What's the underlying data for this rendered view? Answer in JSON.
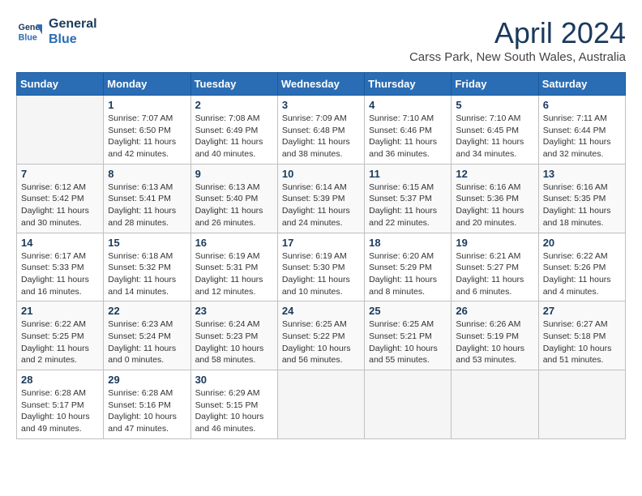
{
  "logo": {
    "line1": "General",
    "line2": "Blue"
  },
  "title": "April 2024",
  "subtitle": "Carss Park, New South Wales, Australia",
  "days_of_week": [
    "Sunday",
    "Monday",
    "Tuesday",
    "Wednesday",
    "Thursday",
    "Friday",
    "Saturday"
  ],
  "weeks": [
    [
      {
        "num": "",
        "detail": ""
      },
      {
        "num": "1",
        "detail": "Sunrise: 7:07 AM\nSunset: 6:50 PM\nDaylight: 11 hours\nand 42 minutes."
      },
      {
        "num": "2",
        "detail": "Sunrise: 7:08 AM\nSunset: 6:49 PM\nDaylight: 11 hours\nand 40 minutes."
      },
      {
        "num": "3",
        "detail": "Sunrise: 7:09 AM\nSunset: 6:48 PM\nDaylight: 11 hours\nand 38 minutes."
      },
      {
        "num": "4",
        "detail": "Sunrise: 7:10 AM\nSunset: 6:46 PM\nDaylight: 11 hours\nand 36 minutes."
      },
      {
        "num": "5",
        "detail": "Sunrise: 7:10 AM\nSunset: 6:45 PM\nDaylight: 11 hours\nand 34 minutes."
      },
      {
        "num": "6",
        "detail": "Sunrise: 7:11 AM\nSunset: 6:44 PM\nDaylight: 11 hours\nand 32 minutes."
      }
    ],
    [
      {
        "num": "7",
        "detail": "Sunrise: 6:12 AM\nSunset: 5:42 PM\nDaylight: 11 hours\nand 30 minutes."
      },
      {
        "num": "8",
        "detail": "Sunrise: 6:13 AM\nSunset: 5:41 PM\nDaylight: 11 hours\nand 28 minutes."
      },
      {
        "num": "9",
        "detail": "Sunrise: 6:13 AM\nSunset: 5:40 PM\nDaylight: 11 hours\nand 26 minutes."
      },
      {
        "num": "10",
        "detail": "Sunrise: 6:14 AM\nSunset: 5:39 PM\nDaylight: 11 hours\nand 24 minutes."
      },
      {
        "num": "11",
        "detail": "Sunrise: 6:15 AM\nSunset: 5:37 PM\nDaylight: 11 hours\nand 22 minutes."
      },
      {
        "num": "12",
        "detail": "Sunrise: 6:16 AM\nSunset: 5:36 PM\nDaylight: 11 hours\nand 20 minutes."
      },
      {
        "num": "13",
        "detail": "Sunrise: 6:16 AM\nSunset: 5:35 PM\nDaylight: 11 hours\nand 18 minutes."
      }
    ],
    [
      {
        "num": "14",
        "detail": "Sunrise: 6:17 AM\nSunset: 5:33 PM\nDaylight: 11 hours\nand 16 minutes."
      },
      {
        "num": "15",
        "detail": "Sunrise: 6:18 AM\nSunset: 5:32 PM\nDaylight: 11 hours\nand 14 minutes."
      },
      {
        "num": "16",
        "detail": "Sunrise: 6:19 AM\nSunset: 5:31 PM\nDaylight: 11 hours\nand 12 minutes."
      },
      {
        "num": "17",
        "detail": "Sunrise: 6:19 AM\nSunset: 5:30 PM\nDaylight: 11 hours\nand 10 minutes."
      },
      {
        "num": "18",
        "detail": "Sunrise: 6:20 AM\nSunset: 5:29 PM\nDaylight: 11 hours\nand 8 minutes."
      },
      {
        "num": "19",
        "detail": "Sunrise: 6:21 AM\nSunset: 5:27 PM\nDaylight: 11 hours\nand 6 minutes."
      },
      {
        "num": "20",
        "detail": "Sunrise: 6:22 AM\nSunset: 5:26 PM\nDaylight: 11 hours\nand 4 minutes."
      }
    ],
    [
      {
        "num": "21",
        "detail": "Sunrise: 6:22 AM\nSunset: 5:25 PM\nDaylight: 11 hours\nand 2 minutes."
      },
      {
        "num": "22",
        "detail": "Sunrise: 6:23 AM\nSunset: 5:24 PM\nDaylight: 11 hours\nand 0 minutes."
      },
      {
        "num": "23",
        "detail": "Sunrise: 6:24 AM\nSunset: 5:23 PM\nDaylight: 10 hours\nand 58 minutes."
      },
      {
        "num": "24",
        "detail": "Sunrise: 6:25 AM\nSunset: 5:22 PM\nDaylight: 10 hours\nand 56 minutes."
      },
      {
        "num": "25",
        "detail": "Sunrise: 6:25 AM\nSunset: 5:21 PM\nDaylight: 10 hours\nand 55 minutes."
      },
      {
        "num": "26",
        "detail": "Sunrise: 6:26 AM\nSunset: 5:19 PM\nDaylight: 10 hours\nand 53 minutes."
      },
      {
        "num": "27",
        "detail": "Sunrise: 6:27 AM\nSunset: 5:18 PM\nDaylight: 10 hours\nand 51 minutes."
      }
    ],
    [
      {
        "num": "28",
        "detail": "Sunrise: 6:28 AM\nSunset: 5:17 PM\nDaylight: 10 hours\nand 49 minutes."
      },
      {
        "num": "29",
        "detail": "Sunrise: 6:28 AM\nSunset: 5:16 PM\nDaylight: 10 hours\nand 47 minutes."
      },
      {
        "num": "30",
        "detail": "Sunrise: 6:29 AM\nSunset: 5:15 PM\nDaylight: 10 hours\nand 46 minutes."
      },
      {
        "num": "",
        "detail": ""
      },
      {
        "num": "",
        "detail": ""
      },
      {
        "num": "",
        "detail": ""
      },
      {
        "num": "",
        "detail": ""
      }
    ]
  ]
}
